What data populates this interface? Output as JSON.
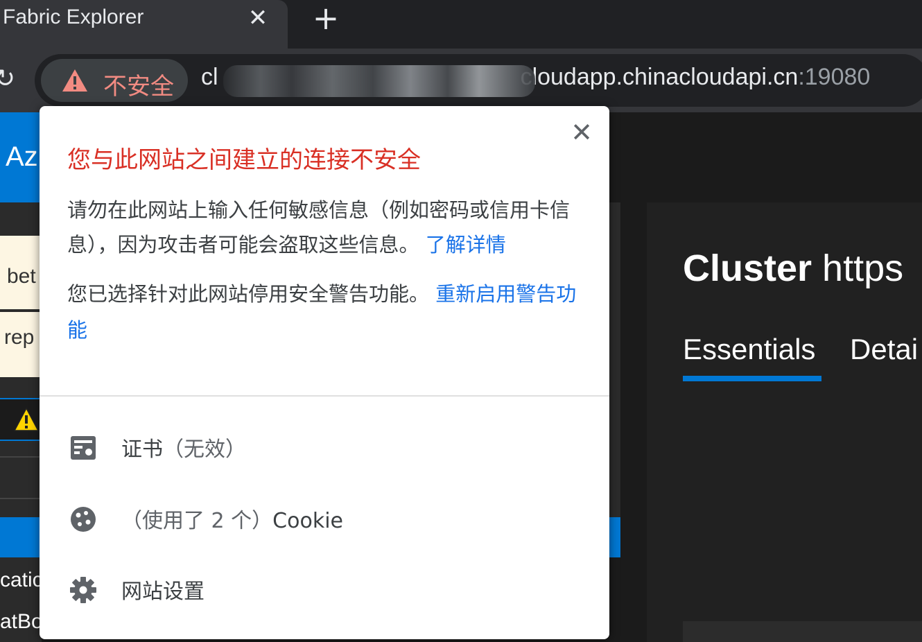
{
  "browser": {
    "tab": {
      "title": "Fabric Explorer",
      "close_icon": "close-icon"
    },
    "new_tab_icon": "plus-icon",
    "reload_icon": "reload-icon",
    "security_chip": {
      "label": "不安全",
      "icon": "warning-triangle-icon",
      "color": "#f28b82"
    },
    "url": {
      "prefix": "cl",
      "host": "cloudapp.chinacloudapi.cn",
      "port": ":19080"
    }
  },
  "background_page": {
    "header_text": "Az",
    "banner_line1": "bet",
    "banner_line2": "rep",
    "side_item1": "catic",
    "side_item2": "atBo",
    "cluster_title_bold": "Cluster",
    "cluster_title_rest": " https",
    "tabs": [
      "Essentials",
      "Detai"
    ]
  },
  "popup": {
    "title": "您与此网站之间建立的连接不安全",
    "body": "请勿在此网站上输入任何敏感信息（例如密码或信用卡信息），因为攻击者可能会盗取这些信息。",
    "learn_more": "了解详情",
    "disabled_text": "您已选择针对此网站停用安全警告功能。",
    "reenable_link": "重新启用警告功能",
    "certificate": {
      "label": "证书",
      "status": "（无效）",
      "icon": "certificate-icon"
    },
    "cookies": {
      "prefix": "（使用了 2 个）",
      "label": "Cookie",
      "icon": "cookie-icon"
    },
    "site_settings": {
      "label": "网站设置",
      "icon": "gear-icon"
    },
    "colors": {
      "title": "#d93025",
      "link": "#1a73e8"
    }
  }
}
